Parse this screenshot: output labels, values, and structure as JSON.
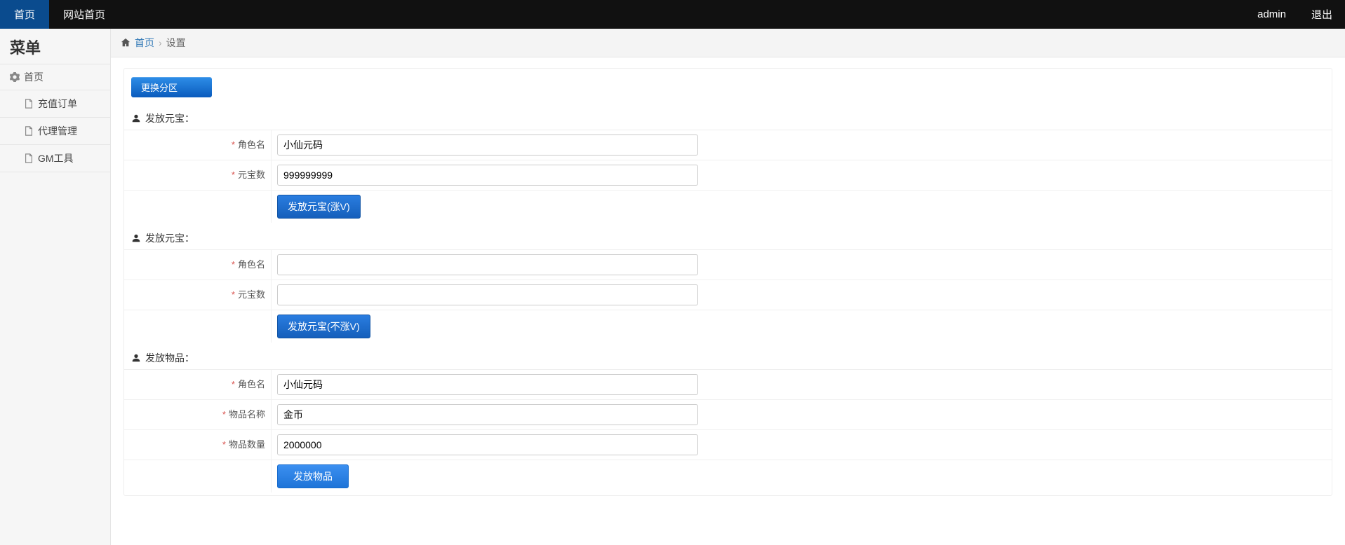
{
  "topnav": {
    "home": "首页",
    "site_home": "网站首页",
    "user": "admin",
    "logout": "退出"
  },
  "sidebar": {
    "title": "菜单",
    "root": "首页",
    "items": [
      "充值订单",
      "代理管理",
      "GM工具"
    ]
  },
  "breadcrumb": {
    "home": "首页",
    "current": "设置"
  },
  "switch_zone_btn": "更换分区",
  "sections": [
    {
      "title": "发放元宝：",
      "fields": [
        {
          "label": "角色名",
          "value": "小仙元码"
        },
        {
          "label": "元宝数",
          "value": "999999999"
        }
      ],
      "action": "发放元宝(涨V)"
    },
    {
      "title": "发放元宝：",
      "fields": [
        {
          "label": "角色名",
          "value": ""
        },
        {
          "label": "元宝数",
          "value": ""
        }
      ],
      "action": "发放元宝(不涨V)"
    },
    {
      "title": "发放物品：",
      "fields": [
        {
          "label": "角色名",
          "value": "小仙元码"
        },
        {
          "label": "物品名称",
          "value": "金币"
        },
        {
          "label": "物品数量",
          "value": "2000000"
        }
      ],
      "action": "发放物品",
      "action_light": true
    }
  ]
}
